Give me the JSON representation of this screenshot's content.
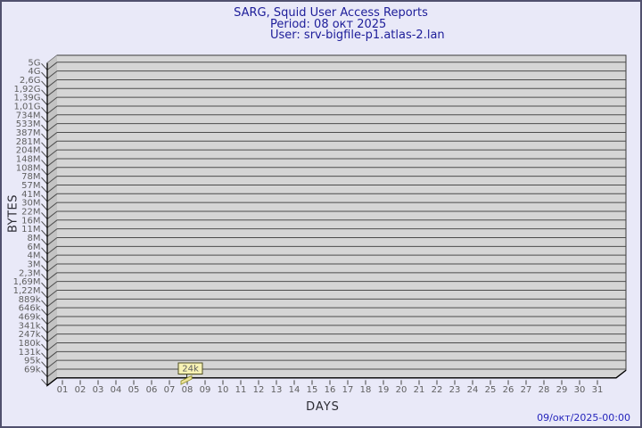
{
  "header": {
    "title": "SARG, Squid User Access Reports",
    "period": "Period: 08 окт 2025",
    "user": "User: srv-bigfile-p1.atlas-2.lan"
  },
  "footer": {
    "generated": "09/окт/2025-00:00"
  },
  "colors": {
    "background": "#e9e9f8",
    "border": "#51516e",
    "title_text": "#1d1d99",
    "timestamp_text": "#2424bb",
    "plot_bg": "#d5d5d5",
    "wall_bg": "#c3c3c3",
    "gridline": "#4c4c4c",
    "tick_text": "#5f5f5f",
    "axis_line": "#000000",
    "bar_fill": "#eee39b",
    "bar_border": "#97972f",
    "label_box_fill": "#f7f2b4",
    "label_box_border": "#4f4f23"
  },
  "chart_data": {
    "type": "bar",
    "title": "SARG, Squid User Access Reports",
    "subtitle": [
      "Period: 08 окт 2025",
      "User: srv-bigfile-p1.atlas-2.lan"
    ],
    "xlabel": "DAYS",
    "ylabel": "BYTES",
    "y_scale": "log",
    "grid": "horizontal",
    "legend_position": "none",
    "y_tick_labels": [
      "5G",
      "4G",
      "2,6G",
      "1,92G",
      "1,39G",
      "1,01G",
      "734M",
      "533M",
      "387M",
      "281M",
      "204M",
      "148M",
      "108M",
      "78M",
      "57M",
      "41M",
      "30M",
      "22M",
      "16M",
      "11M",
      "8M",
      "6M",
      "4M",
      "3M",
      "2,3M",
      "1,69M",
      "1,22M",
      "889k",
      "646k",
      "469k",
      "341k",
      "247k",
      "180k",
      "131k",
      "95k",
      "69k"
    ],
    "categories": [
      "01",
      "02",
      "03",
      "04",
      "05",
      "06",
      "07",
      "08",
      "09",
      "10",
      "11",
      "12",
      "13",
      "14",
      "15",
      "16",
      "17",
      "18",
      "19",
      "20",
      "21",
      "22",
      "23",
      "24",
      "25",
      "26",
      "27",
      "28",
      "29",
      "30",
      "31"
    ],
    "values": [
      0,
      0,
      0,
      0,
      0,
      0,
      0,
      24000,
      0,
      0,
      0,
      0,
      0,
      0,
      0,
      0,
      0,
      0,
      0,
      0,
      0,
      0,
      0,
      0,
      0,
      0,
      0,
      0,
      0,
      0,
      0
    ],
    "points": [
      {
        "category": "08",
        "value": 24000,
        "label": "24k"
      }
    ]
  }
}
